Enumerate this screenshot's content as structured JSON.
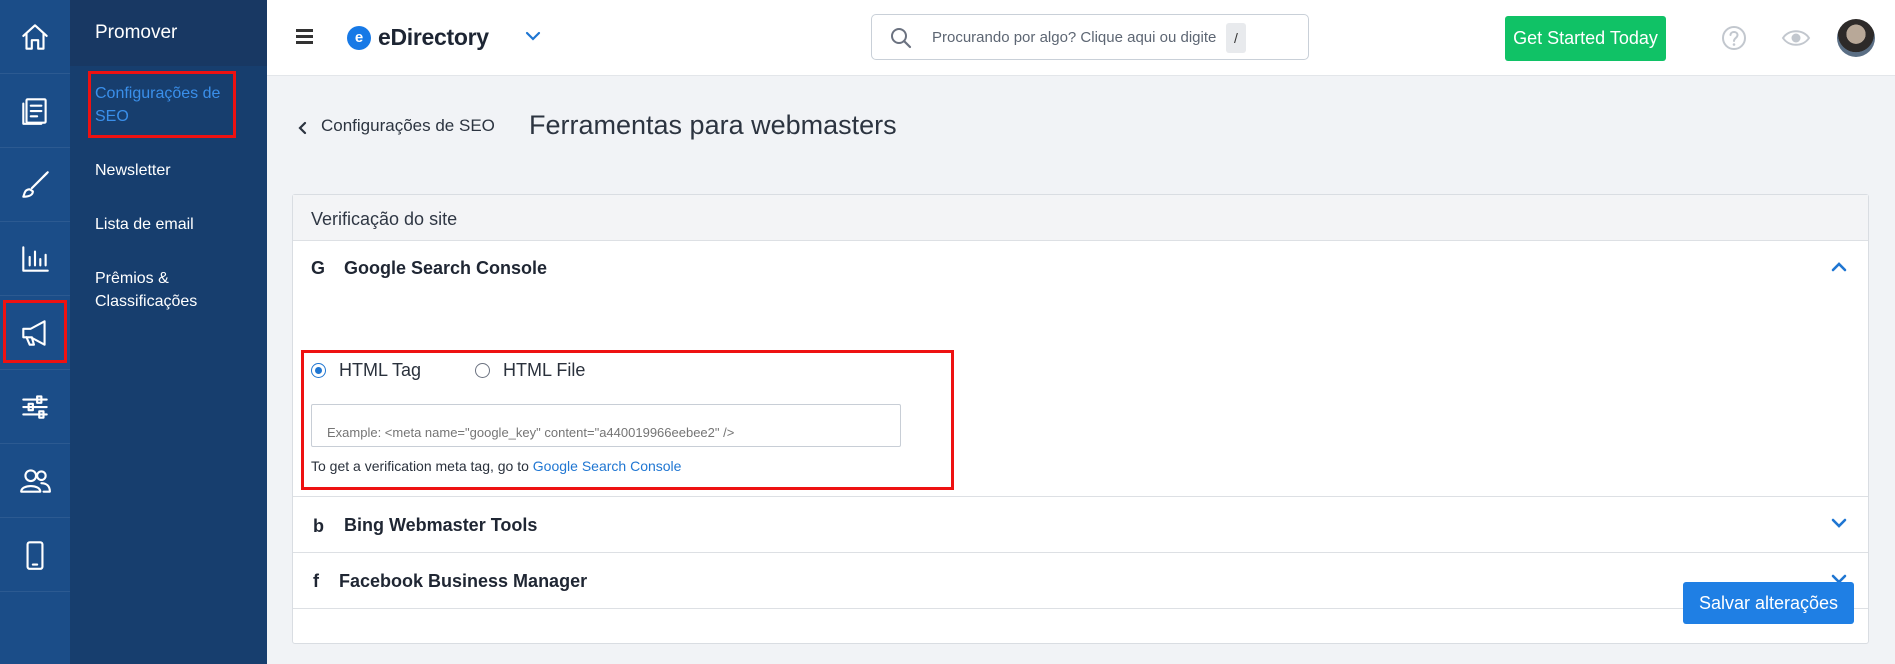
{
  "iconbar": {
    "items": [
      {
        "name": "home"
      },
      {
        "name": "content"
      },
      {
        "name": "design"
      },
      {
        "name": "reports"
      },
      {
        "name": "promote"
      },
      {
        "name": "settings"
      },
      {
        "name": "users"
      },
      {
        "name": "mobile"
      }
    ]
  },
  "subnav": {
    "title": "Promover",
    "items": [
      {
        "label": "Configurações de SEO"
      },
      {
        "label": "Newsletter"
      },
      {
        "label": "Lista de email"
      },
      {
        "label": "Prêmios & Classificações"
      }
    ]
  },
  "topbar": {
    "logo_mark": "e",
    "logo_text": "eDirectory",
    "search_placeholder": "Procurando por algo? Clique aqui ou digite",
    "search_shortcut": "/",
    "cta_label": "Get Started Today"
  },
  "breadcrumb": {
    "back_label": "Configurações de SEO"
  },
  "page": {
    "title": "Ferramentas para webmasters"
  },
  "card": {
    "header": "Verificação do site",
    "google": {
      "icon": "G",
      "title": "Google Search Console",
      "options": [
        {
          "label": "HTML Tag",
          "selected": true
        },
        {
          "label": "HTML File",
          "selected": false
        }
      ],
      "input_placeholder": "Example: <meta name=\"google_key\" content=\"a440019966eebee2\" />",
      "help_prefix": "To get a verification meta tag, go to ",
      "help_link": "Google Search Console"
    },
    "bing": {
      "icon": "b",
      "title": "Bing Webmaster Tools"
    },
    "facebook": {
      "icon": "f",
      "title": "Facebook Business Manager"
    },
    "save_label": "Salvar alterações"
  },
  "colors": {
    "iconbar_bg": "#1b4d88",
    "subnav_bg": "#173e6e",
    "accent": "#1f76d2",
    "cta_green": "#10c266",
    "highlight_red": "#e11111"
  }
}
